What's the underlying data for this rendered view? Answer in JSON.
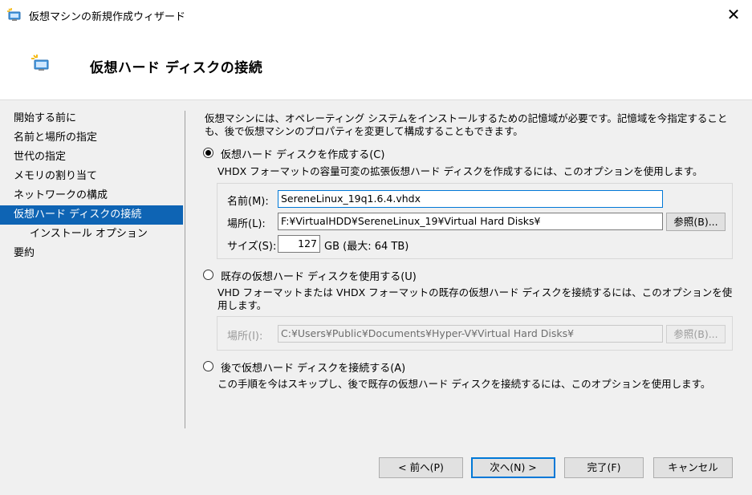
{
  "window": {
    "title": "仮想マシンの新規作成ウィザード",
    "close_glyph": "✕"
  },
  "header": {
    "title": "仮想ハード ディスクの接続"
  },
  "nav": {
    "items": [
      {
        "label": "開始する前に"
      },
      {
        "label": "名前と場所の指定"
      },
      {
        "label": "世代の指定"
      },
      {
        "label": "メモリの割り当て"
      },
      {
        "label": "ネットワークの構成"
      },
      {
        "label": "仮想ハード ディスクの接続"
      },
      {
        "label": "インストール オプション"
      },
      {
        "label": "要約"
      }
    ],
    "selected_index": 5
  },
  "main": {
    "description": "仮想マシンには、オペレーティング システムをインストールするための記憶域が必要です。記憶域を今指定することも、後で仮想マシンのプロパティを変更して構成することもできます。",
    "create": {
      "label": "仮想ハード ディスクを作成する(C)",
      "description": "VHDX フォーマットの容量可変の拡張仮想ハード ディスクを作成するには、このオプションを使用します。",
      "name_label": "名前(M):",
      "name_value": "SereneLinux_19q1.6.4.vhdx",
      "location_label": "場所(L):",
      "location_value": "F:¥VirtualHDD¥SereneLinux_19¥Virtual Hard Disks¥",
      "browse_label": "参照(B)...",
      "size_label": "サイズ(S):",
      "size_value": "127",
      "size_suffix": "GB (最大: 64 TB)"
    },
    "existing": {
      "label": "既存の仮想ハード ディスクを使用する(U)",
      "description": "VHD フォーマットまたは VHDX フォーマットの既存の仮想ハード ディスクを接続するには、このオプションを使用します。",
      "location_label": "場所(I):",
      "location_value": "C:¥Users¥Public¥Documents¥Hyper-V¥Virtual Hard Disks¥",
      "browse_label": "参照(B)..."
    },
    "later": {
      "label": "後で仮想ハード ディスクを接続する(A)",
      "description": "この手順を今はスキップし、後で既存の仮想ハード ディスクを接続するには、このオプションを使用します。"
    }
  },
  "footer": {
    "prev_label": "< 前へ(P)",
    "next_label": "次へ(N) >",
    "finish_label": "完了(F)",
    "cancel_label": "キャンセル"
  },
  "colors": {
    "selection": "#0e64b4",
    "focus_border": "#0078d7"
  }
}
